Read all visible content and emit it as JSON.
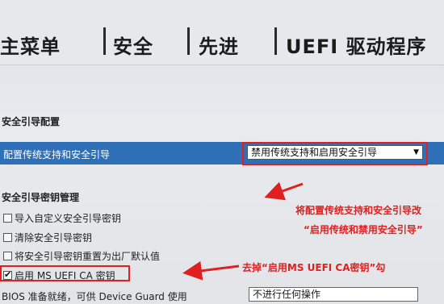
{
  "tabs": [
    "主菜单",
    "安全",
    "先进",
    "UEFI 驱动程序"
  ],
  "section_title": "安全引导配置",
  "config_row": {
    "label": "配置传统支持和安全引导",
    "value": "禁用传统支持和启用安全引导"
  },
  "subsection_title": "安全引导密钥管理",
  "checkboxes": [
    {
      "label": "导入自定义安全引导密钥",
      "checked": false
    },
    {
      "label": "清除安全引导密钥",
      "checked": false
    },
    {
      "label": "将安全引导密钥重置为出厂默认值",
      "checked": false
    },
    {
      "label": "启用 MS UEFI CA 密钥",
      "checked": true
    }
  ],
  "bios_row": {
    "label": "BIOS 准备就绪，可供 Device Guard 使用",
    "value": "不进行任何操作"
  },
  "annotations": {
    "line1": "将配置传统支持和安全引导改",
    "line2": "“启用传统和禁用安全引导”",
    "line3": "去掉“启用MS UEFI CA密钥”勾"
  },
  "colors": {
    "highlight": "#2f6fb8",
    "annotation": "#e02020"
  }
}
